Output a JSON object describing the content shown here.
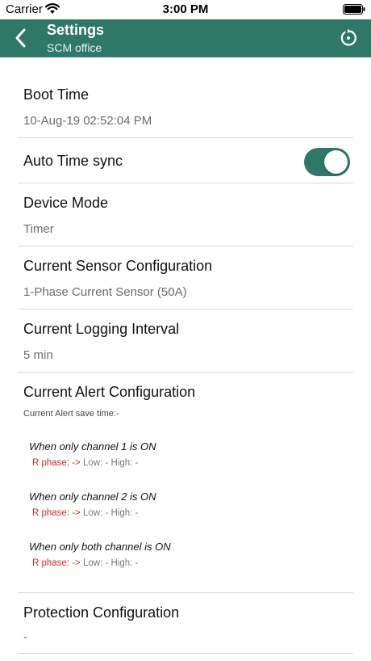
{
  "status_bar": {
    "carrier": "Carrier",
    "time": "3:00 PM"
  },
  "nav": {
    "title": "Settings",
    "subtitle": "SCM office",
    "back_icon": "chevron-left-icon",
    "refresh_icon": "refresh-icon"
  },
  "colors": {
    "nav_background": "#2f7868",
    "toggle_on": "#2f7868",
    "phase_label": "#d62a2a"
  },
  "settings": {
    "boot_time": {
      "label": "Boot Time",
      "value": "10-Aug-19 02:52:04 PM"
    },
    "auto_time_sync": {
      "label": "Auto Time sync",
      "enabled": true
    },
    "device_mode": {
      "label": "Device Mode",
      "value": "Timer"
    },
    "current_sensor": {
      "label": "Current Sensor Configuration",
      "value": "1-Phase Current Sensor (50A)"
    },
    "logging_interval": {
      "label": "Current Logging Interval",
      "value": "5 min"
    },
    "alert_config": {
      "label": "Current Alert Configuration",
      "save_time": "Current Alert save time:-",
      "channels": [
        {
          "title": "When only channel 1 is ON",
          "phase": "R phase: ->",
          "values": "Low: - High: -"
        },
        {
          "title": "When only channel 2 is ON",
          "phase": "R phase: ->",
          "values": "Low: - High: -"
        },
        {
          "title": "When only both channel is ON",
          "phase": "R phase: ->",
          "values": "Low: - High: -"
        }
      ]
    },
    "protection": {
      "label": "Protection Configuration",
      "value": "-"
    }
  }
}
